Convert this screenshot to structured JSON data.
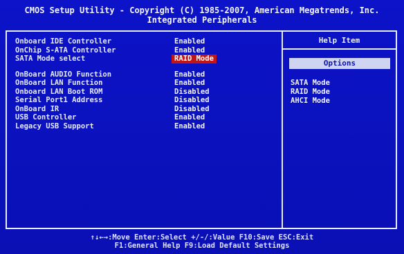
{
  "header": {
    "title_line1": "CMOS Setup Utility - Copyright (C) 1985-2007, American Megatrends, Inc.",
    "title_line2": "Integrated Peripherals"
  },
  "settings": [
    {
      "label": "Onboard IDE Controller",
      "value": "Enabled"
    },
    {
      "label": "OnChip S-ATA Controller",
      "value": "Enabled"
    },
    {
      "label": "SATA Mode select",
      "value": "RAID Mode",
      "selected": true
    },
    {
      "label": "OnBoard AUDIO Function",
      "value": "Enabled"
    },
    {
      "label": "OnBoard LAN Function",
      "value": "Enabled"
    },
    {
      "label": "Onboard LAN Boot ROM",
      "value": "Disabled"
    },
    {
      "label": "Serial Port1 Address",
      "value": "Disabled"
    },
    {
      "label": "OnBoard IR",
      "value": "Disabled"
    },
    {
      "label": "USB Controller",
      "value": "Enabled"
    },
    {
      "label": "Legacy USB Support",
      "value": "Enabled"
    }
  ],
  "help_panel": {
    "title": "Help Item",
    "options_label": "Options",
    "options": [
      "SATA Mode",
      "RAID Mode",
      "AHCI Mode"
    ]
  },
  "footer": {
    "line1": "↑↓←→:Move  Enter:Select  +/-/:Value  F10:Save  ESC:Exit",
    "line2": "F1:General Help      F9:Load Default Settings"
  }
}
